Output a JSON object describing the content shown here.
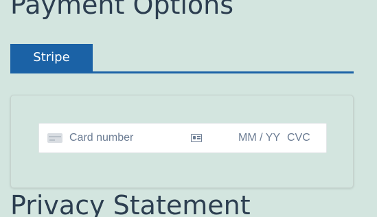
{
  "payment_section": {
    "title": "Payment Options"
  },
  "tabs": [
    {
      "label": "Stripe",
      "active": true
    }
  ],
  "card_form": {
    "card_number_placeholder": "Card number",
    "expiry_placeholder": "MM / YY",
    "cvc_placeholder": "CVC",
    "card_icon": "credit-card-icon",
    "cvc_icon": "id-card-icon"
  },
  "privacy_section": {
    "title": "Privacy Statement"
  },
  "colors": {
    "background": "#d3e5df",
    "accent": "#1b62a6",
    "heading": "#2c3e50",
    "placeholder": "#6b7c93"
  }
}
